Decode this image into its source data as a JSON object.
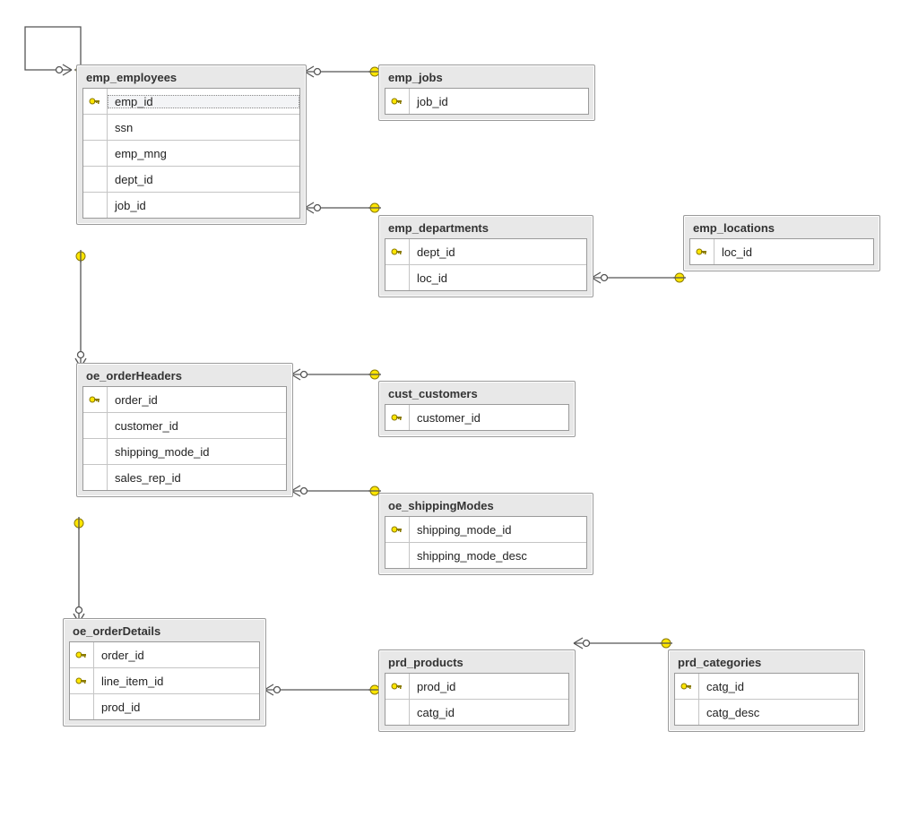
{
  "diagram": {
    "tables": {
      "emp_employees": {
        "title": "emp_employees",
        "columns": [
          {
            "name": "emp_id",
            "pk": true,
            "selected": true
          },
          {
            "name": "ssn",
            "pk": false
          },
          {
            "name": "emp_mng",
            "pk": false
          },
          {
            "name": "dept_id",
            "pk": false
          },
          {
            "name": "job_id",
            "pk": false
          }
        ]
      },
      "emp_jobs": {
        "title": "emp_jobs",
        "columns": [
          {
            "name": "job_id",
            "pk": true
          }
        ]
      },
      "emp_departments": {
        "title": "emp_departments",
        "columns": [
          {
            "name": "dept_id",
            "pk": true
          },
          {
            "name": "loc_id",
            "pk": false
          }
        ]
      },
      "emp_locations": {
        "title": "emp_locations",
        "columns": [
          {
            "name": "loc_id",
            "pk": true
          }
        ]
      },
      "oe_orderHeaders": {
        "title": "oe_orderHeaders",
        "columns": [
          {
            "name": "order_id",
            "pk": true
          },
          {
            "name": "customer_id",
            "pk": false
          },
          {
            "name": "shipping_mode_id",
            "pk": false
          },
          {
            "name": "sales_rep_id",
            "pk": false
          }
        ]
      },
      "cust_customers": {
        "title": "cust_customers",
        "columns": [
          {
            "name": "customer_id",
            "pk": true
          }
        ]
      },
      "oe_shippingModes": {
        "title": "oe_shippingModes",
        "columns": [
          {
            "name": "shipping_mode_id",
            "pk": true
          },
          {
            "name": "shipping_mode_desc",
            "pk": false
          }
        ]
      },
      "oe_orderDetails": {
        "title": "oe_orderDetails",
        "columns": [
          {
            "name": "order_id",
            "pk": true
          },
          {
            "name": "line_item_id",
            "pk": true
          },
          {
            "name": "prod_id",
            "pk": false
          }
        ]
      },
      "prd_products": {
        "title": "prd_products",
        "columns": [
          {
            "name": "prod_id",
            "pk": true
          },
          {
            "name": "catg_id",
            "pk": false
          }
        ]
      },
      "prd_categories": {
        "title": "prd_categories",
        "columns": [
          {
            "name": "catg_id",
            "pk": true
          },
          {
            "name": "catg_desc",
            "pk": false
          }
        ]
      }
    },
    "relationships": [
      {
        "from": "emp_employees",
        "to": "emp_employees",
        "self": true
      },
      {
        "from": "emp_employees",
        "to": "emp_jobs"
      },
      {
        "from": "emp_employees",
        "to": "emp_departments"
      },
      {
        "from": "emp_departments",
        "to": "emp_locations"
      },
      {
        "from": "oe_orderHeaders",
        "to": "emp_employees"
      },
      {
        "from": "oe_orderHeaders",
        "to": "cust_customers"
      },
      {
        "from": "oe_orderHeaders",
        "to": "oe_shippingModes"
      },
      {
        "from": "oe_orderDetails",
        "to": "oe_orderHeaders"
      },
      {
        "from": "oe_orderDetails",
        "to": "prd_products"
      },
      {
        "from": "prd_products",
        "to": "prd_categories"
      }
    ]
  }
}
